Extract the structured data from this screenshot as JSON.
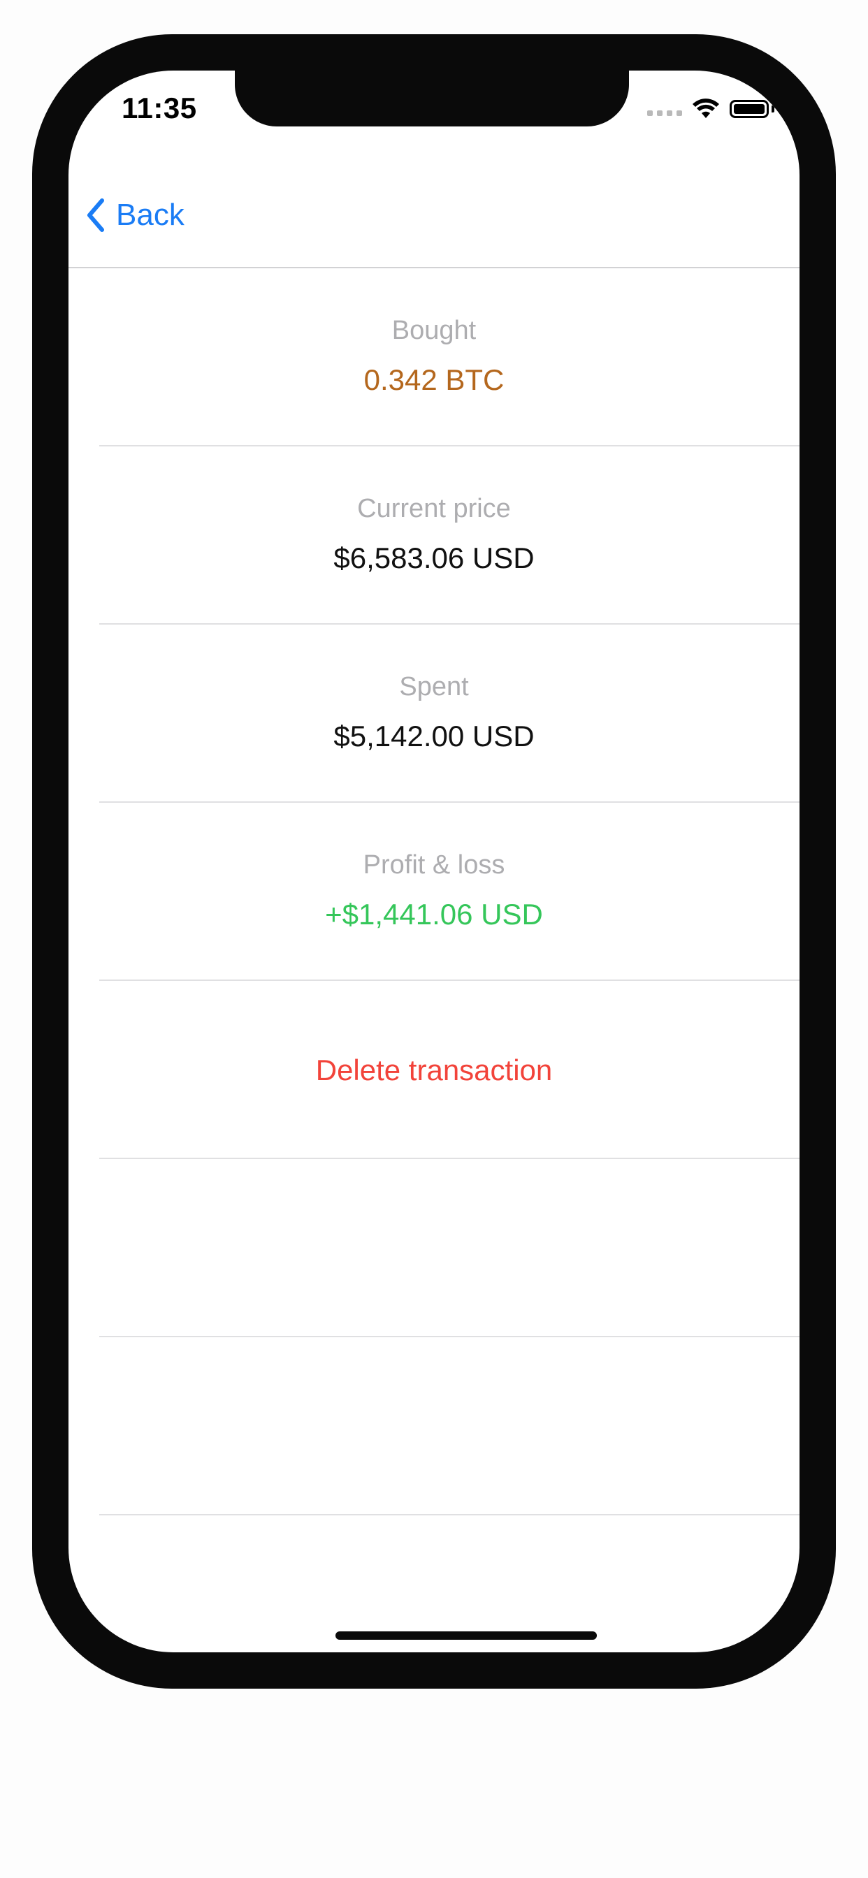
{
  "status_bar": {
    "time": "11:35"
  },
  "nav": {
    "back_label": "Back"
  },
  "colors": {
    "accent": "#1a7cf5",
    "bought": "#b4671d",
    "profit": "#35c65a",
    "delete": "#f2433a",
    "label": "#adadb0"
  },
  "rows": [
    {
      "label": "Bought",
      "value": "0.342 BTC"
    },
    {
      "label": "Current price",
      "value": "$6,583.06 USD"
    },
    {
      "label": "Spent",
      "value": "$5,142.00 USD"
    },
    {
      "label": "Profit & loss",
      "value": "+$1,441.06 USD"
    }
  ],
  "actions": {
    "delete_label": "Delete transaction"
  }
}
